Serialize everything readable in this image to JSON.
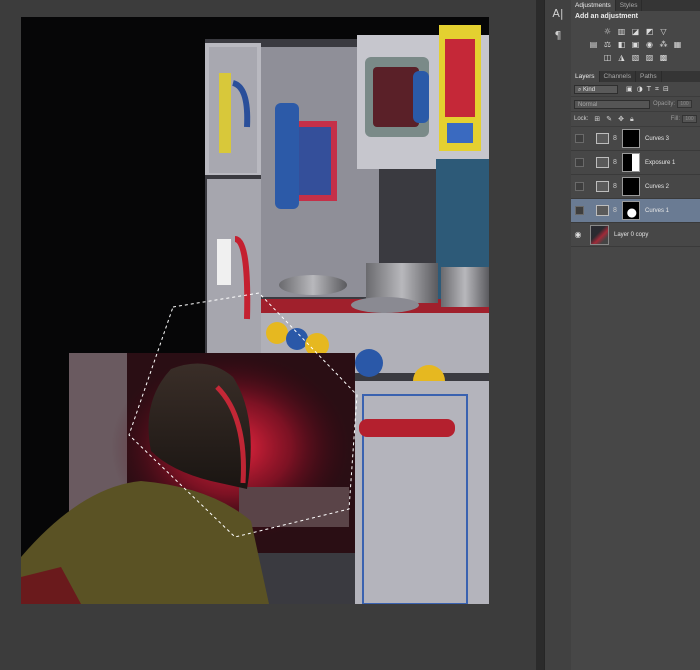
{
  "strip": {
    "btn1": "A|",
    "btn2": "¶"
  },
  "adjustments_panel": {
    "tabs": [
      "Adjustments",
      "Styles"
    ],
    "heading": "Add an adjustment",
    "row1_icons": [
      "brightness-contrast-icon",
      "levels-icon",
      "curves-icon",
      "exposure-icon"
    ],
    "row2_icons": [
      "vibrance-icon",
      "hue-saturation-icon",
      "color-balance-icon",
      "black-white-icon",
      "photo-filter-icon",
      "channel-mixer-icon",
      "color-lookup-icon"
    ],
    "row3_icons": [
      "invert-icon",
      "posterize-icon",
      "threshold-icon",
      "selective-color-icon",
      "gradient-map-icon"
    ]
  },
  "layers_panel": {
    "tabs": [
      "Layers",
      "Channels",
      "Paths"
    ],
    "kind_label": "Kind",
    "blend_mode": "Normal",
    "opacity_label": "Opacity:",
    "opacity_value": "100",
    "lock_label": "Lock:",
    "fill_label": "Fill:",
    "fill_value": "100",
    "layers": [
      {
        "name": "Curves 3",
        "type": "curves",
        "visible": false,
        "selected": false
      },
      {
        "name": "Exposure 1",
        "type": "exposure",
        "visible": false,
        "selected": false
      },
      {
        "name": "Curves 2",
        "type": "curves",
        "visible": false,
        "selected": false
      },
      {
        "name": "Curves 1",
        "type": "curves",
        "visible": false,
        "selected": true
      },
      {
        "name": "Layer 0 copy",
        "type": "pixel",
        "visible": true,
        "selected": false
      }
    ]
  },
  "colors": {
    "canvas_bg": "#3c3c3c",
    "panel_bg": "#474747",
    "selection_blue": "#6a7b93",
    "oven_glow": "#e0203a"
  }
}
